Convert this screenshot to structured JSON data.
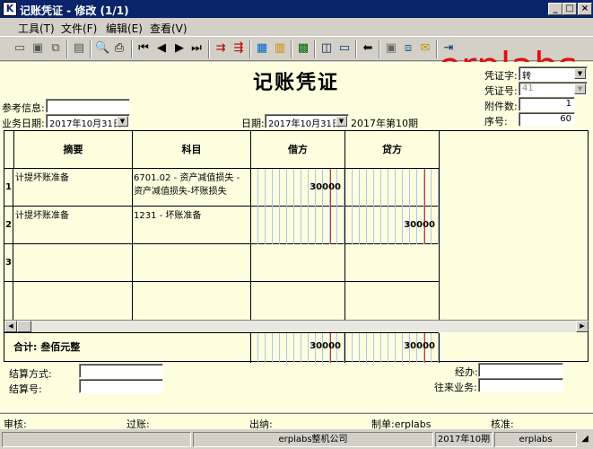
{
  "window": {
    "title": "记账凭证 - 修改 (1/1)",
    "app_icon_letter": "K"
  },
  "menu": [
    "工具(T)",
    "文件(F)",
    "编辑(E)",
    "查看(V)"
  ],
  "brand_text": "erplabs",
  "voucher": {
    "title": "记账凭证",
    "ref_label": "参考信息:",
    "ref_value": "",
    "biz_date_label": "业务日期:",
    "biz_date_value": "2017年10月31日",
    "date_label": "日期:",
    "date_value": "2017年10月31日",
    "period_text": "2017年第10期",
    "voucher_word_label": "凭证字:",
    "voucher_word_value": "转",
    "voucher_no_label": "凭证号:",
    "voucher_no_value": "41",
    "attach_label": "附件数:",
    "attach_value": "1",
    "seq_label": "序号:",
    "seq_value": "60"
  },
  "grid": {
    "headers": {
      "summary": "摘要",
      "account": "科目",
      "debit": "借方",
      "credit": "贷方"
    },
    "rows": [
      {
        "no": "1",
        "summary": "计提坏账准备",
        "account": "6701.02 - 资产减值损失 - 资产减值损失-坏账损失",
        "debit": "30000",
        "credit": ""
      },
      {
        "no": "2",
        "summary": "计提坏账准备",
        "account": "1231 - 坏账准备",
        "debit": "",
        "credit": "30000"
      },
      {
        "no": "3",
        "summary": "",
        "account": "",
        "debit": "",
        "credit": ""
      }
    ],
    "total_label": "合计:  叁佰元整",
    "total_debit": "30000",
    "total_credit": "30000"
  },
  "settle": {
    "method_label": "结算方式:",
    "method_value": "",
    "no_label": "结算号:",
    "no_value": "",
    "handler_label": "经办:",
    "handler_value": "",
    "contact_label": "往来业务:",
    "contact_value": ""
  },
  "signatures": {
    "audit": "审核:",
    "post": "过账:",
    "cashier": "出纳:",
    "maker": "制单:erplabs",
    "check": "核准:"
  },
  "status": {
    "company": "erplabs整机公司",
    "period": "2017年10期",
    "user": "erplabs"
  }
}
